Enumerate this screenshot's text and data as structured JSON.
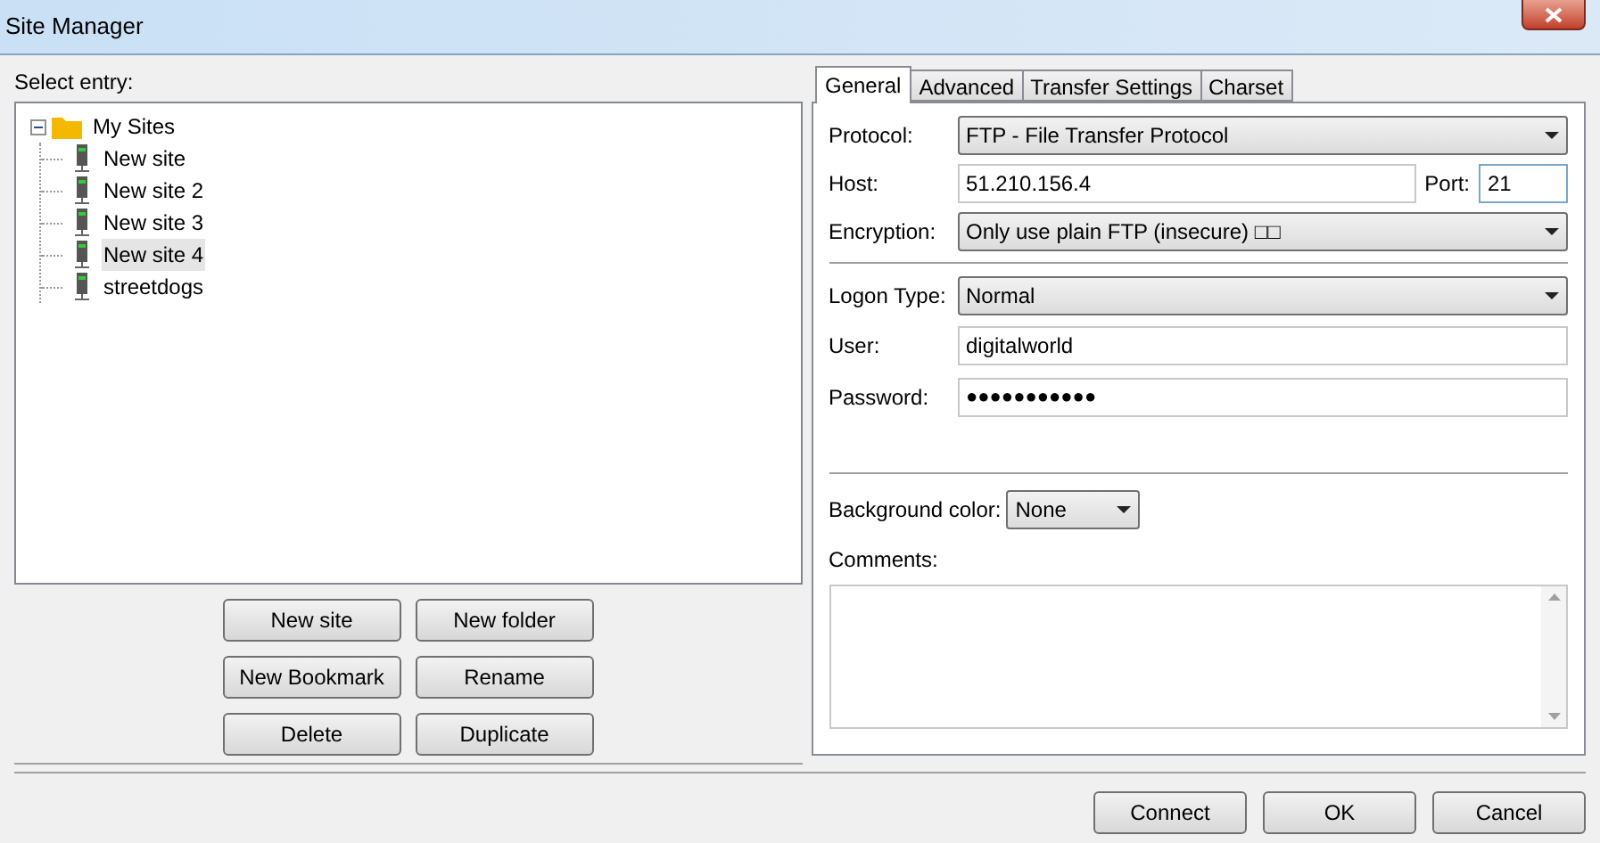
{
  "window": {
    "title": "Site Manager"
  },
  "select_label": "Select entry:",
  "tree": [
    {
      "label": "My Sites",
      "kind": "folder",
      "expanded": true,
      "selected": false,
      "children": [
        {
          "label": "New site",
          "kind": "site",
          "selected": false
        },
        {
          "label": "New site 2",
          "kind": "site",
          "selected": false
        },
        {
          "label": "New site 3",
          "kind": "site",
          "selected": false
        },
        {
          "label": "New site 4",
          "kind": "site",
          "selected": true
        },
        {
          "label": "streetdogs",
          "kind": "site",
          "selected": false
        }
      ]
    }
  ],
  "tree_buttons": [
    "New site",
    "New folder",
    "New Bookmark",
    "Rename",
    "Delete",
    "Duplicate"
  ],
  "tabs": [
    {
      "label": "General",
      "selected": true
    },
    {
      "label": "Advanced",
      "selected": false
    },
    {
      "label": "Transfer Settings",
      "selected": false
    },
    {
      "label": "Charset",
      "selected": false
    }
  ],
  "general": {
    "protocol": {
      "label": "Protocol:",
      "value": "FTP - File Transfer Protocol"
    },
    "host": {
      "label": "Host:",
      "value": "51.210.156.4"
    },
    "port": {
      "label": "Port:",
      "value": "21"
    },
    "encryption": {
      "label": "Encryption:",
      "value": "Only use plain FTP (insecure) □□"
    },
    "logon_type": {
      "label": "Logon Type:",
      "value": "Normal"
    },
    "user": {
      "label": "User:",
      "value": "digitalworld"
    },
    "password": {
      "label": "Password:",
      "value": "●●●●●●●●●●●"
    },
    "background_color": {
      "label": "Background color:",
      "value": "None"
    },
    "comments": {
      "label": "Comments:"
    }
  },
  "buttons": [
    "Connect",
    "OK",
    "Cancel"
  ]
}
